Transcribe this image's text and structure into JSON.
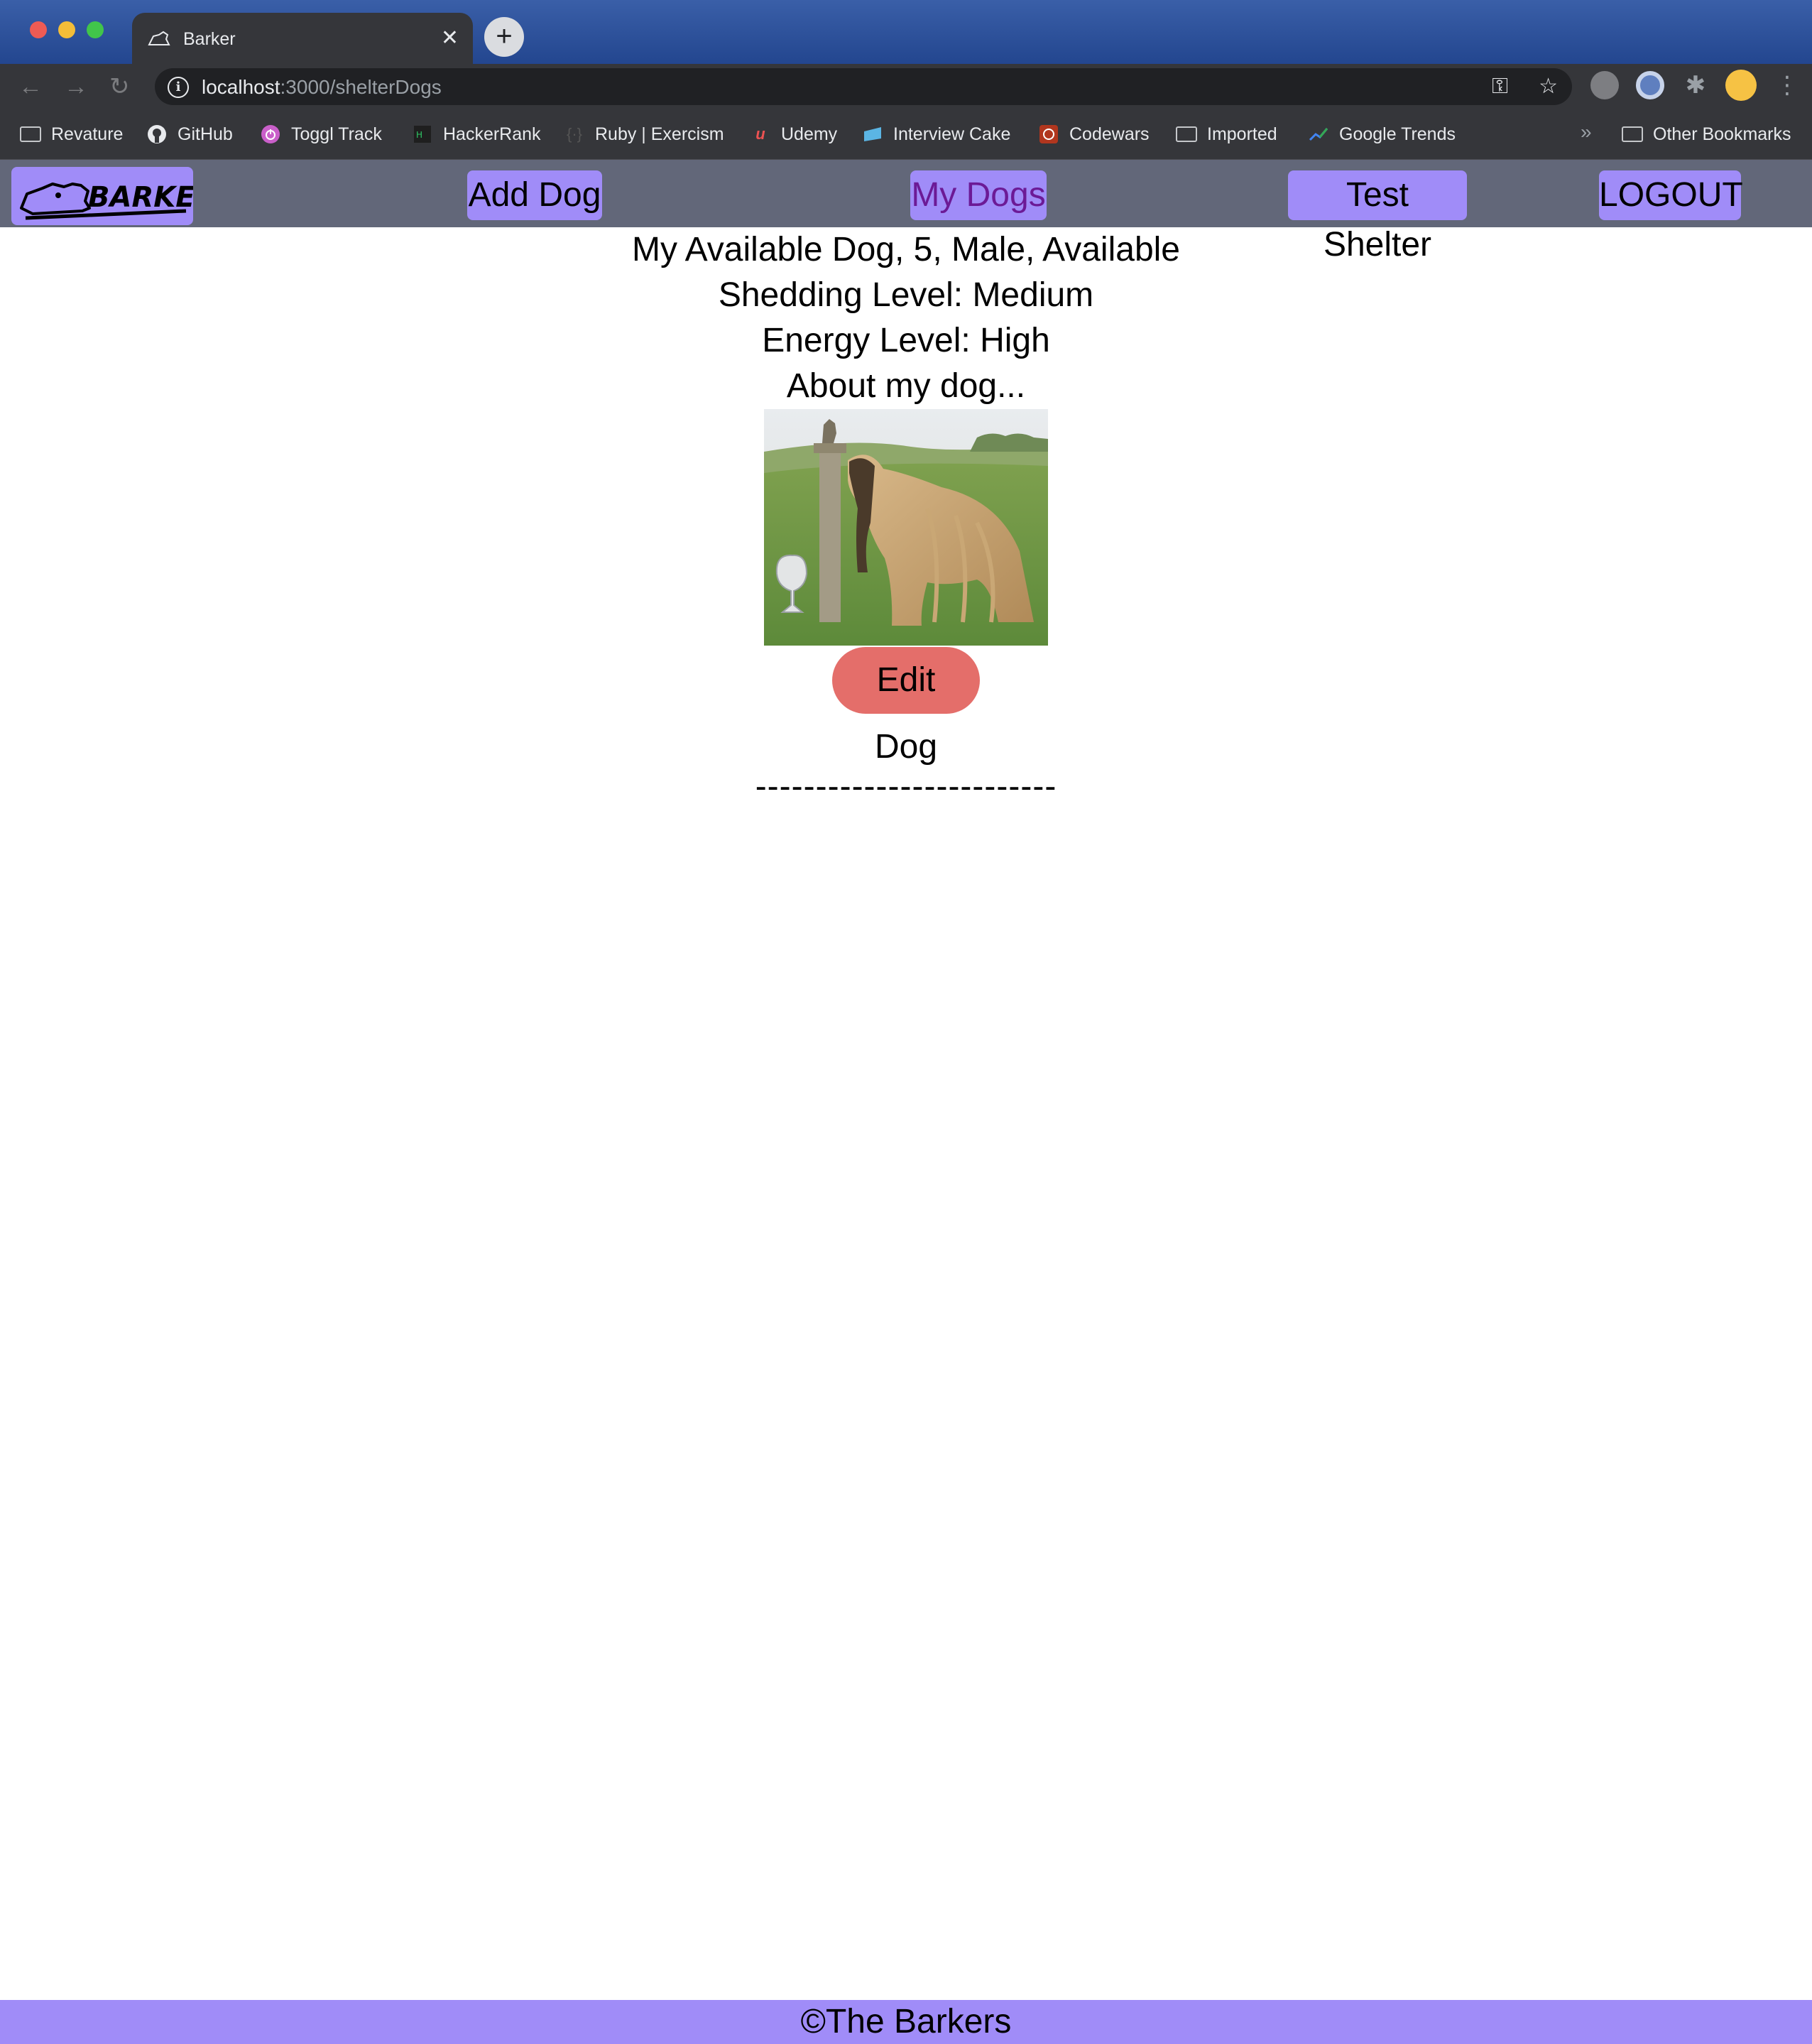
{
  "browser": {
    "tab_title": "Barker",
    "tab_close": "✕",
    "new_tab": "+",
    "url_host": "localhost",
    "url_rest": ":3000/shelterDogs",
    "bookmarks": [
      {
        "label": "Revature",
        "icon": "folder-icon"
      },
      {
        "label": "GitHub",
        "icon": "github-icon"
      },
      {
        "label": "Toggl Track",
        "icon": "toggl-icon"
      },
      {
        "label": "HackerRank",
        "icon": "hackerrank-icon"
      },
      {
        "label": "Ruby | Exercism",
        "icon": "exercism-icon"
      },
      {
        "label": "Udemy",
        "icon": "udemy-icon"
      },
      {
        "label": "Interview Cake",
        "icon": "interview-cake-icon"
      },
      {
        "label": "Codewars",
        "icon": "codewars-icon"
      },
      {
        "label": "Imported",
        "icon": "folder-icon"
      },
      {
        "label": "Google Trends",
        "icon": "google-trends-icon"
      }
    ],
    "overflow": "»",
    "other_bookmarks": "Other Bookmarks"
  },
  "app": {
    "logo_text": "BARKER",
    "nav": {
      "add_dog": "Add Dog",
      "my_dogs": "My Dogs",
      "shelter": "Test Shelter",
      "logout": "LOGOUT"
    },
    "dog": {
      "summary": "My Available Dog, 5, Male, Available",
      "shedding": "Shedding Level: Medium",
      "energy": "Energy Level: High",
      "about": "About my dog..."
    },
    "edit_button": "Edit Dog",
    "divider": "-------------------------",
    "footer": "©The Barkers"
  },
  "colors": {
    "nav_bar": "#626779",
    "accent": "#a08cf8",
    "active_link": "#6c1a96",
    "edit_button": "#e46e6a"
  }
}
